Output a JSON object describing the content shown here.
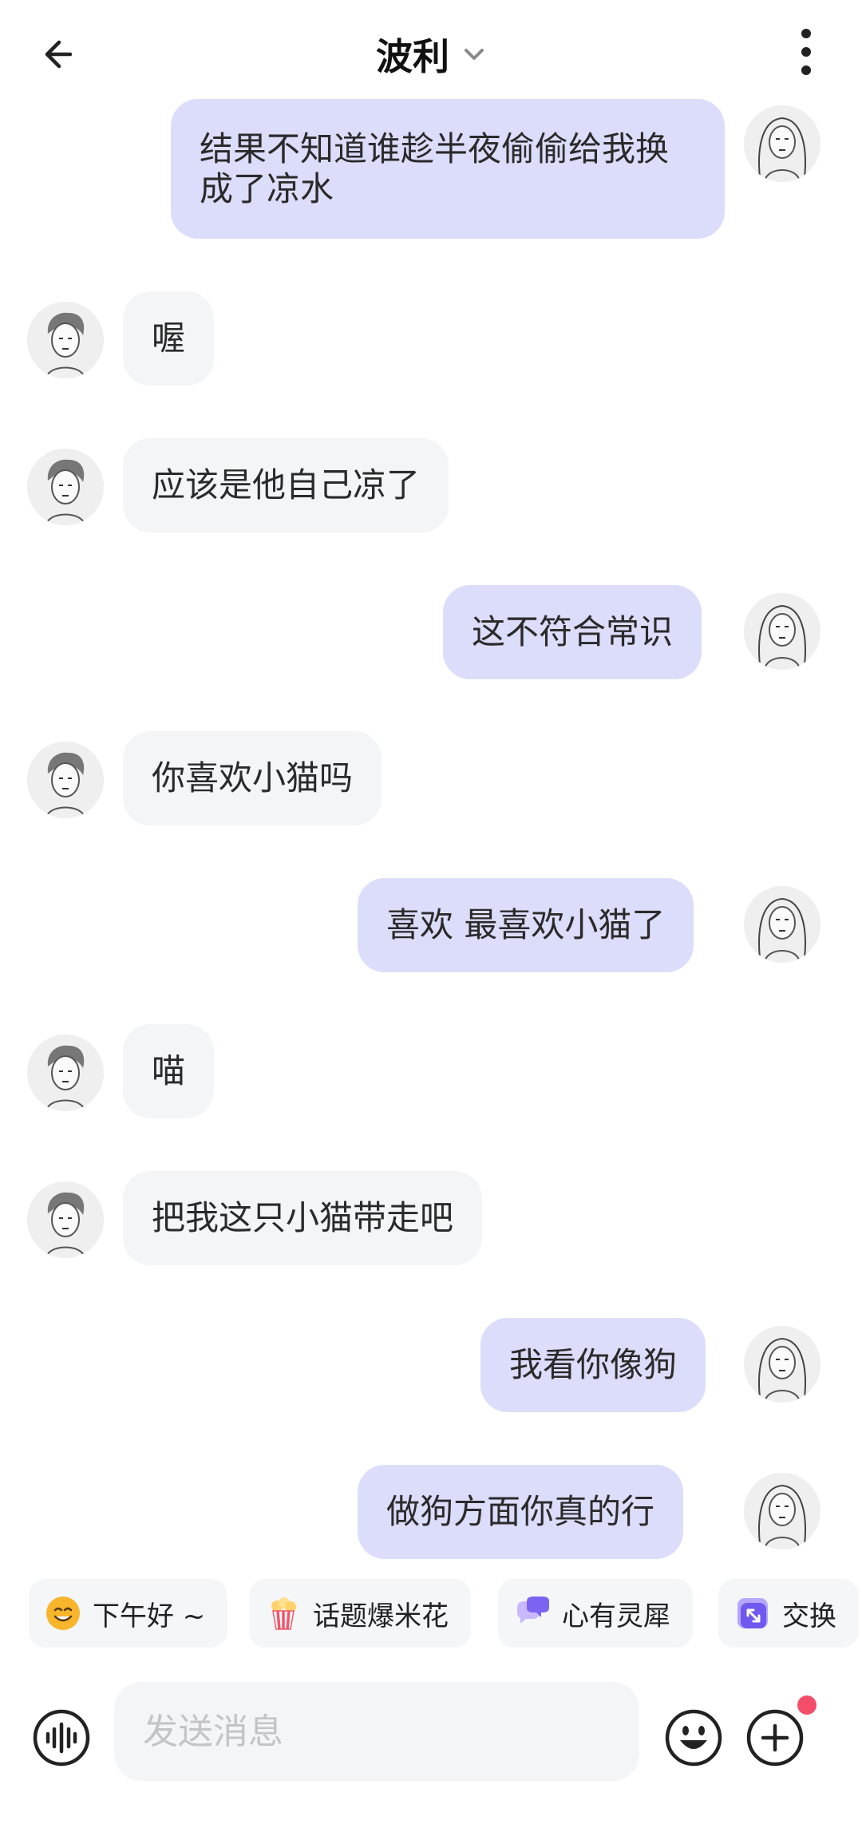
{
  "header": {
    "title": "波利"
  },
  "messages": [
    {
      "side": "out",
      "text": "结果不知道谁趁半夜偷偷给我换成了凉水"
    },
    {
      "side": "in",
      "text": "喔"
    },
    {
      "side": "in",
      "text": "应该是他自己凉了"
    },
    {
      "side": "out",
      "text": "这不符合常识"
    },
    {
      "side": "in",
      "text": "你喜欢小猫吗"
    },
    {
      "side": "out",
      "text": "喜欢 最喜欢小猫了"
    },
    {
      "side": "in",
      "text": "喵"
    },
    {
      "side": "in",
      "text": "把我这只小猫带走吧"
    },
    {
      "side": "out",
      "text": "我看你像狗"
    },
    {
      "side": "out",
      "text": "做狗方面你真的行"
    }
  ],
  "quick_chips": [
    {
      "label": "下午好 ~",
      "icon": "smile-emoji-icon"
    },
    {
      "label": "话题爆米花",
      "icon": "popcorn-icon"
    },
    {
      "label": "心有灵犀",
      "icon": "chat-bubbles-icon"
    },
    {
      "label": "交换",
      "icon": "swap-icon"
    }
  ],
  "composer": {
    "placeholder": "发送消息"
  },
  "colors": {
    "outgoing_bubble": "#dcdcfb",
    "incoming_bubble": "#f4f5f7",
    "notification_dot": "#f44d6a"
  }
}
